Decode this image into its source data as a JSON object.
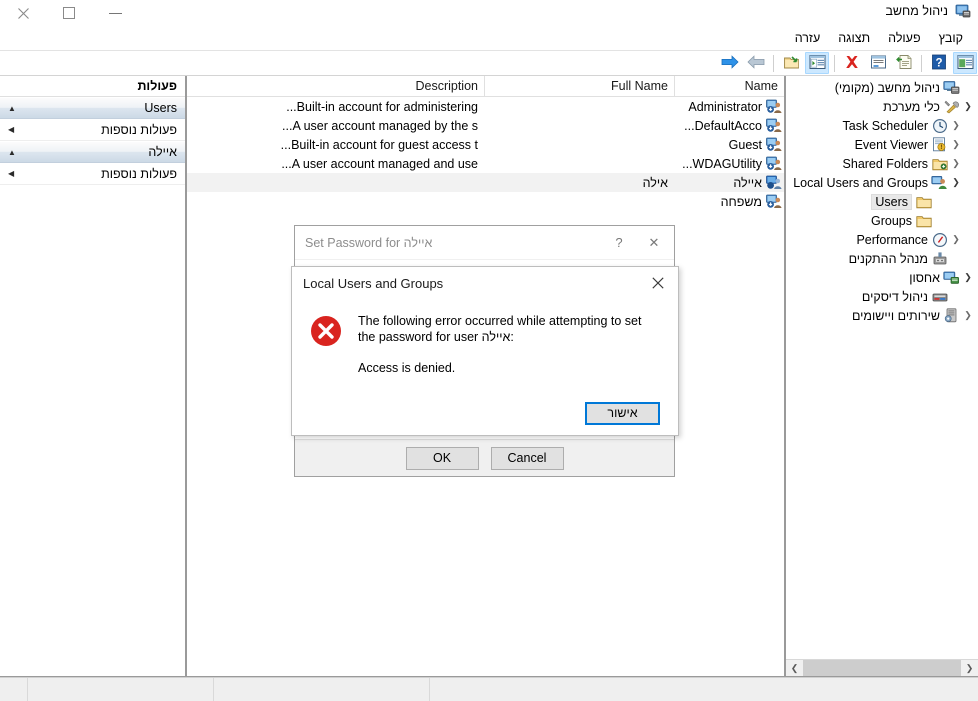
{
  "window": {
    "title": "ניהול מחשב",
    "title_icon": "computer-management-icon",
    "controls": {
      "close": "close-icon",
      "maximize": "maximize-icon",
      "minimize": "minimize-icon"
    }
  },
  "menubar": {
    "items": [
      {
        "label": "קובץ",
        "name": "menu-file"
      },
      {
        "label": "פעולה",
        "name": "menu-action"
      },
      {
        "label": "תצוגה",
        "name": "menu-view"
      },
      {
        "label": "עזרה",
        "name": "menu-help"
      }
    ]
  },
  "toolbar": {
    "buttons": [
      {
        "name": "show-hide-console-tree-button",
        "icon": "console-tree-icon",
        "pressed": true
      },
      {
        "name": "help-button",
        "icon": "question-mark-icon",
        "pressed": false
      },
      {
        "name": "export-list-button",
        "icon": "export-list-icon",
        "pressed": false
      },
      {
        "name": "properties-button",
        "icon": "properties-window-icon",
        "pressed": false
      },
      {
        "name": "delete-button",
        "icon": "red-x-delete-icon",
        "pressed": false
      },
      {
        "name": "show-action-pane-button",
        "icon": "action-pane-icon",
        "pressed": true
      },
      {
        "name": "new-window-button",
        "icon": "new-window-folder-icon",
        "pressed": false
      },
      {
        "name": "back-button",
        "icon": "left-arrow-icon",
        "pressed": false
      },
      {
        "name": "forward-button",
        "icon": "right-arrow-icon",
        "pressed": false
      }
    ]
  },
  "tree": {
    "nodes": [
      {
        "label": "ניהול מחשב (מקומי)",
        "icon": "computer-icon",
        "indent": 0,
        "expander": "none",
        "selected": false
      },
      {
        "label": "כלי מערכת",
        "icon": "system-tools-icon",
        "indent": 0,
        "expander": "open",
        "selected": false
      },
      {
        "label": "Task Scheduler",
        "icon": "clock-icon",
        "indent": 1,
        "expander": "closed",
        "selected": false
      },
      {
        "label": "Event Viewer",
        "icon": "event-viewer-icon",
        "indent": 1,
        "expander": "closed",
        "selected": false
      },
      {
        "label": "Shared Folders",
        "icon": "shared-folders-icon",
        "indent": 1,
        "expander": "closed",
        "selected": false
      },
      {
        "label": "Local Users and Groups",
        "icon": "local-users-groups-icon",
        "indent": 1,
        "expander": "open",
        "selected": false
      },
      {
        "label": "Users",
        "icon": "folder-icon",
        "indent": 2,
        "expander": "none",
        "selected": true
      },
      {
        "label": "Groups",
        "icon": "folder-icon",
        "indent": 2,
        "expander": "none",
        "selected": false
      },
      {
        "label": "Performance",
        "icon": "performance-gauge-icon",
        "indent": 1,
        "expander": "closed",
        "selected": false
      },
      {
        "label": "מנהל ההתקנים",
        "icon": "device-manager-icon",
        "indent": 1,
        "expander": "none",
        "selected": false
      },
      {
        "label": "אחסון",
        "icon": "storage-icon",
        "indent": 0,
        "expander": "open",
        "selected": false
      },
      {
        "label": "ניהול דיסקים",
        "icon": "disk-management-icon",
        "indent": 1,
        "expander": "none",
        "selected": false
      },
      {
        "label": "שירותים ויישומים",
        "icon": "services-applications-icon",
        "indent": 0,
        "expander": "closed",
        "selected": false
      }
    ],
    "scrollbar": {
      "left_arrow": "chevron-left-icon",
      "right_arrow": "chevron-right-icon"
    }
  },
  "list": {
    "columns": [
      {
        "label": "Name",
        "name": "column-name"
      },
      {
        "label": "Full Name",
        "name": "column-full-name"
      },
      {
        "label": "Description",
        "name": "column-description"
      }
    ],
    "rows": [
      {
        "name": "Administrator",
        "full_name": "",
        "description": "Built-in account for administering...",
        "icon": "user-account-icon",
        "selected": false
      },
      {
        "name": "DefaultAcco...",
        "full_name": "",
        "description": "A user account managed by the s...",
        "icon": "user-account-icon",
        "selected": false
      },
      {
        "name": "Guest",
        "full_name": "",
        "description": "Built-in account for guest access t...",
        "icon": "user-account-icon",
        "selected": false
      },
      {
        "name": "WDAGUtility...",
        "full_name": "",
        "description": "A user account managed and use...",
        "icon": "user-account-icon",
        "selected": false
      },
      {
        "name": "איילה",
        "full_name": "אילה",
        "description": "",
        "icon": "user-account-selected-icon",
        "selected": true
      },
      {
        "name": "משפחה",
        "full_name": "",
        "description": "",
        "icon": "user-account-icon",
        "selected": false
      }
    ]
  },
  "actions": {
    "title": "פעולות",
    "groups": [
      {
        "header": "Users",
        "header_arrow": "chevron-up-icon",
        "items": [
          {
            "label": "פעולות נוספות",
            "arrow": "chevron-left-icon",
            "name": "more-actions-users"
          }
        ]
      },
      {
        "header": "איילה",
        "header_arrow": "chevron-up-icon",
        "items": [
          {
            "label": "פעולות נוספות",
            "arrow": "chevron-left-icon",
            "name": "more-actions-ayala"
          }
        ]
      }
    ]
  },
  "statusbar": {
    "cells": [
      "",
      "",
      "",
      ""
    ]
  },
  "set_password_dialog": {
    "title": "Set Password for איילה",
    "help_glyph": "?",
    "close_glyph": "✕",
    "ok_label": "OK",
    "cancel_label": "Cancel"
  },
  "error_dialog": {
    "title": "Local Users and Groups",
    "close_glyph": "✕",
    "icon": "error-icon",
    "message_line1": "The following error occurred while attempting to set the password for user איילה:",
    "message_line2": "Access is denied.",
    "ok_label": "אישור"
  },
  "colors": {
    "accent": "#0078d7",
    "error_red": "#d9322a",
    "toolbar_pressed": "#cce8ff",
    "selection_gray": "#f2f2f2",
    "window_bg": "#ffffff",
    "dialog_bg": "#f0f0f0"
  }
}
